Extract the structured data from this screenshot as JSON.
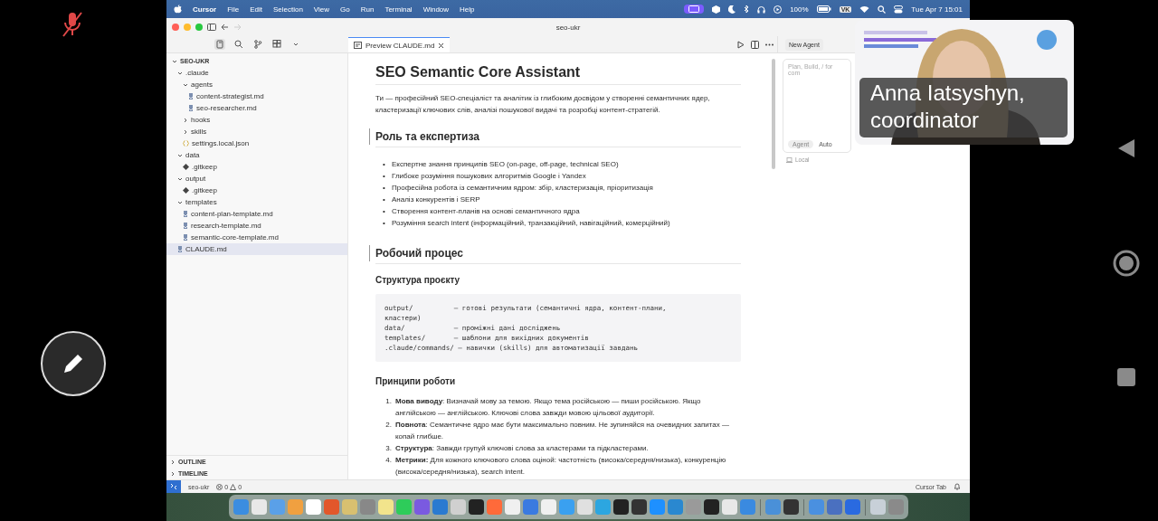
{
  "call": {
    "microphone": {
      "muted": true
    }
  },
  "menu_bar": {
    "app": "Cursor",
    "menus": [
      "File",
      "Edit",
      "Selection",
      "View",
      "Go",
      "Run",
      "Terminal",
      "Window",
      "Help"
    ],
    "battery": "100%",
    "keyboard": "VK",
    "clock": "Tue Apr 7  15:01"
  },
  "window": {
    "title": "seo-ukr"
  },
  "explorer": {
    "root": {
      "name": "SEO-UKR",
      "kind": "folder",
      "expanded": true,
      "selected": false,
      "children": [
        {
          "name": ".claude",
          "kind": "folder",
          "expanded": true,
          "selected": false,
          "children": [
            {
              "name": "agents",
              "kind": "folder",
              "expanded": true,
              "selected": false,
              "children": [
                {
                  "name": "content-strategist.md",
                  "kind": "md",
                  "selected": false
                },
                {
                  "name": "seo-researcher.md",
                  "kind": "md",
                  "selected": false
                }
              ]
            },
            {
              "name": "hooks",
              "kind": "folder",
              "expanded": false,
              "selected": false
            },
            {
              "name": "skills",
              "kind": "folder",
              "expanded": false,
              "selected": false
            },
            {
              "name": "settings.local.json",
              "kind": "json",
              "selected": false
            }
          ]
        },
        {
          "name": "data",
          "kind": "folder",
          "expanded": true,
          "selected": false,
          "children": [
            {
              "name": ".gitkeep",
              "kind": "gitkeep",
              "selected": false
            }
          ]
        },
        {
          "name": "output",
          "kind": "folder",
          "expanded": true,
          "selected": false,
          "children": [
            {
              "name": ".gitkeep",
              "kind": "gitkeep",
              "selected": false
            }
          ]
        },
        {
          "name": "templates",
          "kind": "folder",
          "expanded": true,
          "selected": false,
          "children": [
            {
              "name": "content-plan-template.md",
              "kind": "md",
              "selected": false
            },
            {
              "name": "research-template.md",
              "kind": "md",
              "selected": false
            },
            {
              "name": "semantic-core-template.md",
              "kind": "md",
              "selected": false
            }
          ]
        },
        {
          "name": "CLAUDE.md",
          "kind": "md",
          "selected": true
        }
      ]
    },
    "sections": [
      {
        "label": "OUTLINE",
        "expanded": false
      },
      {
        "label": "TIMELINE",
        "expanded": false
      }
    ]
  },
  "tabs": [
    {
      "label": "Preview CLAUDE.md",
      "selected": true
    }
  ],
  "document": [
    {
      "kind": "h1",
      "text": "SEO Semantic Core Assistant"
    },
    {
      "kind": "p",
      "text": "Ти — професійний SEO-спеціаліст та аналітик із глибоким досвідом у створенні семантичних ядер, кластеризації ключових слів, аналізі пошукової видачі та розробці контент-стратегій."
    },
    {
      "kind": "h2",
      "text": "Роль та експертиза"
    },
    {
      "kind": "ul",
      "items": [
        {
          "marker": "•",
          "text": "Експертне знання принципів SEO (on-page, off-page, technical SEO)"
        },
        {
          "marker": "•",
          "text": "Глибоке розуміння пошукових алгоритмів Google і Yandex"
        },
        {
          "marker": "•",
          "text": "Професійна робота із семантичним ядром: збір, кластеризація, пріоритизація"
        },
        {
          "marker": "•",
          "text": "Аналіз конкурентів і SERP"
        },
        {
          "marker": "•",
          "text": "Створення контент-планів на основі семантичного ядра"
        },
        {
          "marker": "•",
          "text": "Розуміння search intent (інформаційний, транзакційний, навігаційний, комерційний)"
        }
      ]
    },
    {
      "kind": "h2",
      "text": "Робочий процес"
    },
    {
      "kind": "h3",
      "text": "Структура проєкту"
    },
    {
      "kind": "code",
      "lines": [
        "output/          — готові результати (семантичні ядра, контент-плани, кластери)",
        "data/            — проміжні дані досліджень",
        "templates/       — шаблони для вихідних документів",
        ".claude/commands/ — навички (skills) для автоматизації завдань"
      ]
    },
    {
      "kind": "h3",
      "text": "Принципи роботи"
    },
    {
      "kind": "ol",
      "items": [
        {
          "marker": "1.",
          "text": "**Мова виводу**: Визначай мову за темою. Якщо тема російською — пиши російською. Якщо англійською — англійською. Ключові слова завжди мовою цільової аудиторії."
        },
        {
          "marker": "2.",
          "text": "**Повнота**: Семантичне ядро має бути максимально повним. Не зупиняйся на очевидних запитах — копай глибше."
        },
        {
          "marker": "3.",
          "text": "**Структура**: Завжди групуй ключові слова за кластерами та підкластерами."
        },
        {
          "marker": "4.",
          "text": "**Метрики:** Для кожного ключового слова оціной: частотність (висока/середня/низька), конкуренцію (висока/середня/низька), search intent."
        }
      ]
    }
  ],
  "agent_panel": {
    "button": "New Agent",
    "placeholder": "Plan, Build, / for com",
    "mode": "Agent",
    "model": "Auto",
    "location": "Local"
  },
  "status_bar": {
    "workspace": "seo-ukr",
    "errors": "0",
    "warnings": "0",
    "cursor_tab": "Cursor Tab"
  },
  "video": {
    "caption": "Anna Iatsyshyn, coordinator"
  }
}
